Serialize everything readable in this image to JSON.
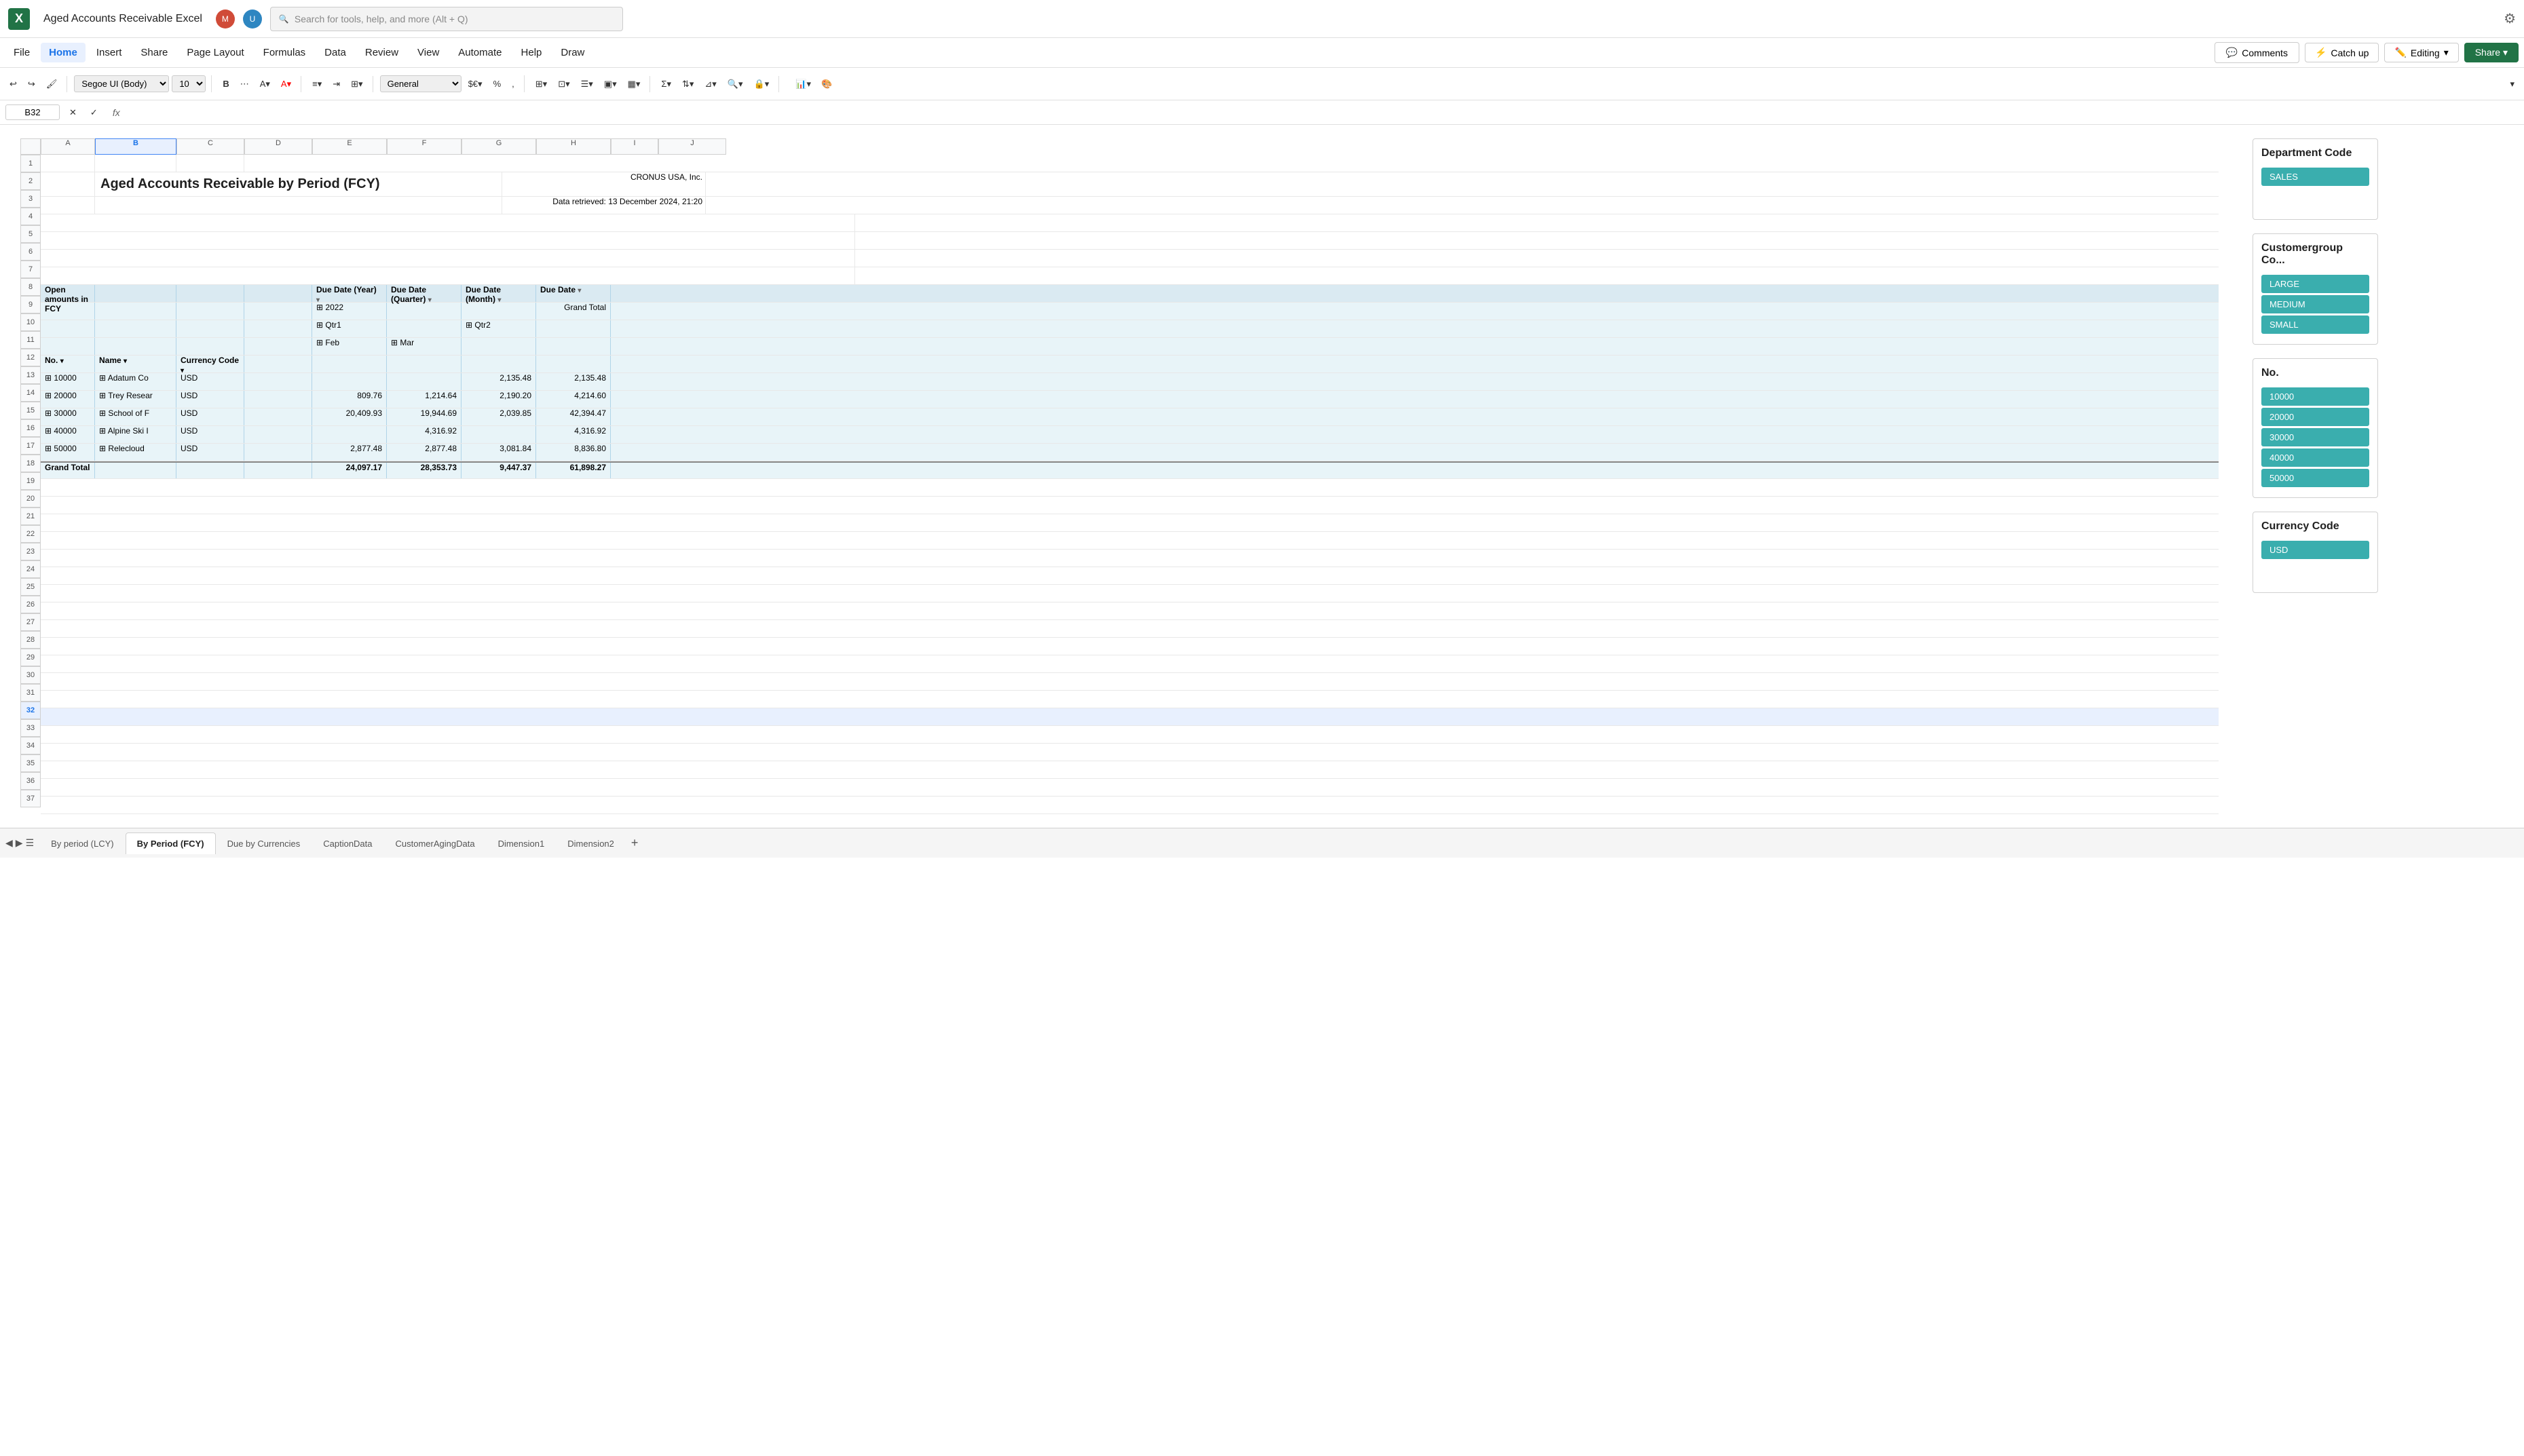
{
  "titleBar": {
    "appName": "Aged Accounts Receivable Excel",
    "searchPlaceholder": "Search for tools, help, and more (Alt + Q)",
    "profileIcons": [
      "profile1",
      "profile2"
    ]
  },
  "menuBar": {
    "items": [
      "File",
      "Home",
      "Insert",
      "Share",
      "Page Layout",
      "Formulas",
      "Data",
      "Review",
      "View",
      "Automate",
      "Help",
      "Draw"
    ],
    "activeItem": "Home",
    "actions": {
      "comments": "Comments",
      "catchup": "Catch up",
      "editing": "Editing",
      "share": "Share"
    }
  },
  "formulaBar": {
    "cellRef": "B32",
    "formula": ""
  },
  "report": {
    "title": "Aged Accounts Receivable by Period (FCY)",
    "company": "CRONUS USA, Inc.",
    "dataRetrieved": "Data retrieved: 13 December 2024, 21:20"
  },
  "pivotTable": {
    "openAmountsLabel": "Open amounts in FCY",
    "columns": {
      "dueDateYear": "Due Date (Year)",
      "dueDateQuarter": "Due Date (Quarter)",
      "dueDateMonth": "Due Date (Month)",
      "dueDate": "Due Date",
      "year2022": "2022",
      "grandTotal": "Grand Total",
      "qtr1": "Qtr1",
      "qtr2": "Qtr2",
      "feb": "Feb",
      "mar": "Mar"
    },
    "rowHeaders": [
      "No.",
      "Name",
      "Currency Code"
    ],
    "rows": [
      {
        "no": "10000",
        "name": "Adatum Co",
        "currency": "USD",
        "qtr1feb": "",
        "qtr1mar": "",
        "qtr2mar": "2,135.48",
        "grandTotal": "2,135.48"
      },
      {
        "no": "20000",
        "name": "Trey Resear",
        "currency": "USD",
        "qtr1feb": "809.76",
        "qtr1mar": "1,214.64",
        "qtr2mar": "2,190.20",
        "grandTotal": "4,214.60"
      },
      {
        "no": "30000",
        "name": "School of F",
        "currency": "USD",
        "qtr1feb": "20,409.93",
        "qtr1mar": "19,944.69",
        "qtr2mar": "2,039.85",
        "grandTotal": "42,394.47"
      },
      {
        "no": "40000",
        "name": "Alpine Ski I",
        "currency": "USD",
        "qtr1feb": "",
        "qtr1mar": "4,316.92",
        "qtr2mar": "",
        "grandTotal": "4,316.92"
      },
      {
        "no": "50000",
        "name": "Relecloud",
        "currency": "USD",
        "qtr1feb": "2,877.48",
        "qtr1mar": "2,877.48",
        "qtr2mar": "3,081.84",
        "grandTotal": "8,836.80"
      }
    ],
    "grandTotal": {
      "label": "Grand Total",
      "qtr1feb": "24,097.17",
      "qtr1mar": "28,353.73",
      "qtr2mar": "9,447.37",
      "grandTotal": "61,898.27"
    }
  },
  "filterPanels": {
    "departmentCode": {
      "title": "Department Code",
      "items": [
        "SALES"
      ]
    },
    "customergroupCode": {
      "title": "Customergroup Co...",
      "items": [
        "LARGE",
        "MEDIUM",
        "SMALL"
      ]
    },
    "no": {
      "title": "No.",
      "items": [
        "10000",
        "20000",
        "30000",
        "40000",
        "50000"
      ]
    },
    "currencyCode": {
      "title": "Currency Code",
      "items": [
        "USD"
      ]
    }
  },
  "sheetTabs": {
    "tabs": [
      "By period (LCY)",
      "By Period (FCY)",
      "Due by Currencies",
      "CaptionData",
      "CustomerAgingData",
      "Dimension1",
      "Dimension2"
    ],
    "activeTab": "By Period (FCY)",
    "addLabel": "+"
  },
  "columns": {
    "widths": [
      50,
      90,
      160,
      100,
      80,
      70,
      120,
      120,
      120,
      120,
      120,
      120,
      130,
      130
    ]
  }
}
